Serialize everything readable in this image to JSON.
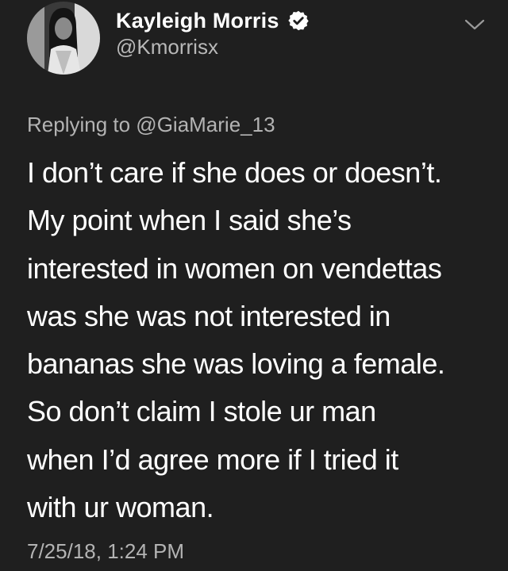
{
  "author": {
    "display_name": "Kayleigh Morris",
    "handle": "@Kmorrisx",
    "verified_icon": "verified-badge-icon"
  },
  "header": {
    "menu_icon": "chevron-down-icon"
  },
  "reply": {
    "text": "Replying to @GiaMarie_13"
  },
  "tweet": {
    "lines": [
      "I don’t care if she does or doesn’t.",
      "My point when I said she’s",
      "interested in women on vendettas",
      "was she was not interested in",
      "bananas she was loving a female.",
      "So don’t claim I stole ur man",
      "when I’d agree more if I tried it",
      "with ur woman."
    ],
    "timestamp": "7/25/18, 1:24 PM"
  },
  "colors": {
    "background": "#1f1f1f",
    "primary_text": "#ffffff",
    "secondary_text": "#b3b3b3"
  }
}
